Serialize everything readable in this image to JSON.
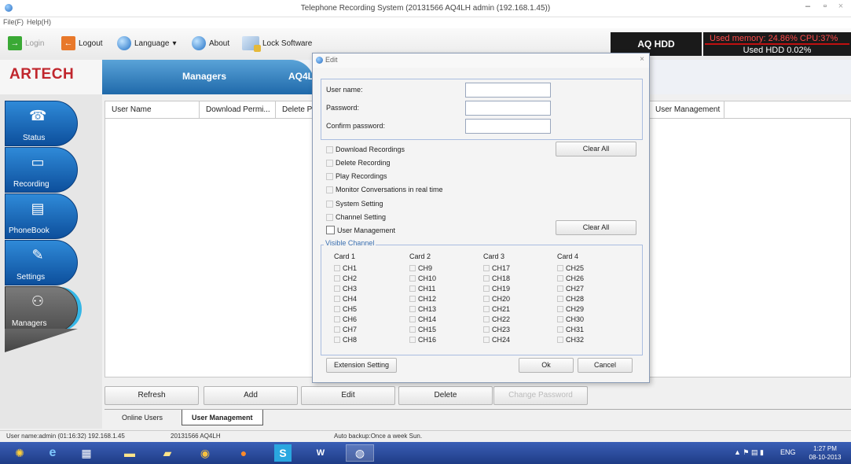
{
  "window": {
    "title": "Telephone Recording System (20131566 AQ4LH admin (192.168.1.45))",
    "min": "–",
    "max": "▫",
    "close": "×"
  },
  "menu": {
    "file": "File(F)",
    "help": "Help(H)"
  },
  "toolbar": {
    "login": "Login",
    "logout": "Logout",
    "language": "Language",
    "language_arrow": "▾",
    "about": "About",
    "lock": "Lock Software"
  },
  "status_panel": {
    "hdd_label": "AQ HDD",
    "memory_cpu": "Used memory: 24.86% CPU:37%",
    "used_hdd": "Used HDD 0.02%"
  },
  "logo": "ARTECH",
  "header_tabs": {
    "managers": "Managers",
    "aq": "AQ4L"
  },
  "sidebar": {
    "items": [
      {
        "label": "Status",
        "icon": "status-icon",
        "glyph": "☎"
      },
      {
        "label": "Recording",
        "icon": "recording-icon",
        "glyph": "▭"
      },
      {
        "label": "PhoneBook",
        "icon": "phonebook-icon",
        "glyph": "▤"
      },
      {
        "label": "Settings",
        "icon": "wrench-icon",
        "glyph": "✎"
      },
      {
        "label": "Managers",
        "icon": "users-icon",
        "glyph": "⚇"
      }
    ]
  },
  "table": {
    "columns": [
      "User Name",
      "Download Permi...",
      "Delete Pe",
      "User Management"
    ]
  },
  "buttons": {
    "refresh": "Refresh",
    "add": "Add",
    "edit": "Edit",
    "delete": "Delete",
    "change_password": "Change Password"
  },
  "tabs": {
    "online_users": "Online Users",
    "user_management": "User Management"
  },
  "statusbar": {
    "user": "User name:admin (01:16:32) 192.168.1.45",
    "device": "20131566 AQ4LH",
    "backup": "Auto backup:Once a week Sun."
  },
  "taskbar": {
    "lang": "ENG",
    "time": "1:27 PM",
    "date": "08-10-2013",
    "tray_icons": "▲  ⚑  ▤  ▮"
  },
  "dialog": {
    "title": "Edit",
    "close": "×",
    "username_label": "User name:",
    "username_value": "",
    "password_label": "Password:",
    "password_value": "",
    "confirm_label": "Confirm password:",
    "confirm_value": "",
    "permissions": [
      "Download Recordings",
      "Delete Recording",
      "Play Recordings",
      "Monitor Conversations in real time",
      "System Setting",
      "Channel Setting",
      "User Management"
    ],
    "clear_all_1": "Clear All",
    "clear_all_2": "Clear All",
    "visible_channel": "Visible Channel",
    "cards": [
      {
        "name": "Card 1",
        "channels": [
          "CH1",
          "CH2",
          "CH3",
          "CH4",
          "CH5",
          "CH6",
          "CH7",
          "CH8"
        ]
      },
      {
        "name": "Card 2",
        "channels": [
          "CH9",
          "CH10",
          "CH11",
          "CH12",
          "CH13",
          "CH14",
          "CH15",
          "CH16"
        ]
      },
      {
        "name": "Card 3",
        "channels": [
          "CH17",
          "CH18",
          "CH19",
          "CH20",
          "CH21",
          "CH22",
          "CH23",
          "CH24"
        ]
      },
      {
        "name": "Card 4",
        "channels": [
          "CH25",
          "CH26",
          "CH27",
          "CH28",
          "CH29",
          "CH30",
          "CH31",
          "CH32"
        ]
      }
    ],
    "extension_setting": "Extension Setting",
    "ok": "Ok",
    "cancel": "Cancel"
  }
}
